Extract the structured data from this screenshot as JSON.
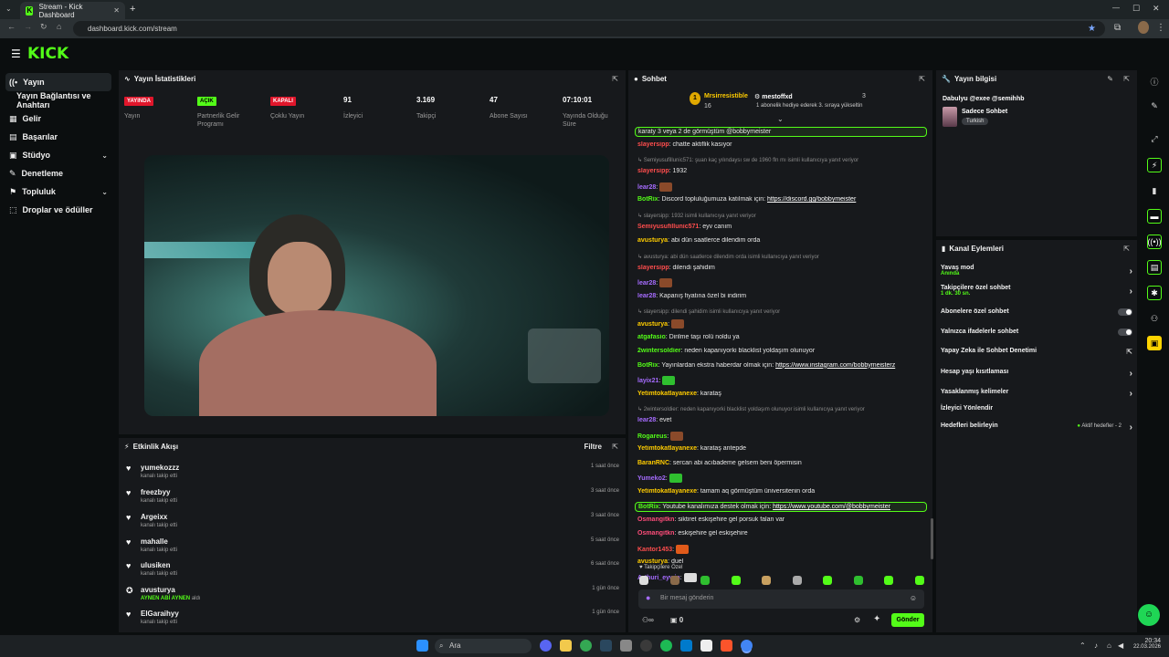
{
  "browser": {
    "tab_title": "Stream - Kick Dashboard",
    "url": "dashboard.kick.com/stream",
    "new_tab": "+",
    "minimize": "—",
    "maximize": "☐",
    "close": "✕"
  },
  "app": {
    "logo": "KICK"
  },
  "sidebar": {
    "items": [
      {
        "label": "Yayın",
        "icon": "live-icon"
      },
      {
        "label": "Yayın Bağlantısı ve Anahtarı"
      },
      {
        "label": "Gelir",
        "icon": "revenue-icon"
      },
      {
        "label": "Başarılar",
        "icon": "achievements-icon"
      },
      {
        "label": "Stüdyo",
        "icon": "studio-icon"
      },
      {
        "label": "Denetleme",
        "icon": "moderation-icon"
      },
      {
        "label": "Topluluk",
        "icon": "community-icon"
      },
      {
        "label": "Droplar ve ödüller",
        "icon": "drops-icon"
      }
    ]
  },
  "stats": {
    "title": "Yayın İstatistikleri",
    "items": [
      {
        "value": "YAYINDA",
        "label": "Yayın",
        "badge_color": "#e0162b"
      },
      {
        "value": "AÇIK",
        "label": "Partnerlik Gelir Programı",
        "badge_color": "#53fc18"
      },
      {
        "value": "KAPALI",
        "label": "Çoklu Yayın",
        "badge_color": "#e0162b"
      },
      {
        "value": "91",
        "label": "İzleyici"
      },
      {
        "value": "3.169",
        "label": "Takipçi"
      },
      {
        "value": "47",
        "label": "Abone Sayısı"
      },
      {
        "value": "07:10:01",
        "label": "Yayında Olduğu Süre"
      }
    ]
  },
  "activity": {
    "title": "Etkinlik Akışı",
    "filter": "Filtre",
    "rows": [
      {
        "user": "yumekozzz",
        "action": "kanalı takip etti",
        "time": "1 saat önce"
      },
      {
        "user": "freezbyy",
        "action": "kanalı takip etti",
        "time": "3 saat önce"
      },
      {
        "user": "Argeixx",
        "action": "kanalı takip etti",
        "time": "3 saat önce"
      },
      {
        "user": "mahalle",
        "action": "kanalı takip etti",
        "time": "5 saat önce"
      },
      {
        "user": "ulusiken",
        "action": "kanalı takip etti",
        "time": "6 saat önce"
      },
      {
        "user": "avusturya",
        "action_prefix": "AYNEN ABİ AYNEN",
        "action": "aldı",
        "time": "1 gün önce"
      },
      {
        "user": "ElGaraihyy",
        "action": "kanalı takip etti",
        "time": "1 gün önce"
      }
    ]
  },
  "chat": {
    "title": "Sohbet",
    "pinned_user1": "Mrsirresistible",
    "pinned_count1": "16",
    "pinned_user2": "mestoffxd",
    "pinned_count2": "3",
    "pinned_note": "1 abonelik hediye ederek 3. sıraya yükseltin",
    "lines": [
      {
        "u": "",
        "t": "karaty 3 veya 2 de görmüştüm @bobbymeister",
        "hl": true
      },
      {
        "u": "slayersipp",
        "c": "#ff4d4d",
        "t": ": chatte aktiflik kasıyor"
      },
      {
        "reply": "Semiyusufillunic571: şuan kaç yılındaysı sw de 1960 fln mı isimli kullanıcıya yanıt veriyor"
      },
      {
        "u": "slayersipp",
        "c": "#ff4d4d",
        "t": ": 1932"
      },
      {
        "u": "lear28",
        "c": "#a66cff",
        "t": ": ",
        "emote": "#8a4a2a"
      },
      {
        "u": "BotRix",
        "c": "#53fc18",
        "t": ": Discord topluluğumuza katılmak için: ",
        "link": "https://discord.gg/bobbymeister"
      },
      {
        "reply": "slayersipp: 1932 isimli kullanıcıya yanıt veriyor"
      },
      {
        "u": "Semiyusufillunic571",
        "c": "#ff4d4d",
        "t": ": eyv canım"
      },
      {
        "u": "avusturya",
        "c": "#ffcc00",
        "t": ": abi dün saatlerce dilendim orda"
      },
      {
        "reply": "avusturya: abi dün saatlerce dilendim orda isimli kullanıcıya yanıt veriyor"
      },
      {
        "u": "slayersipp",
        "c": "#ff4d4d",
        "t": ": dilendi şahidim"
      },
      {
        "u": "lear28",
        "c": "#a66cff",
        "t": ": ",
        "emote": "#8a4a2a"
      },
      {
        "u": "lear28",
        "c": "#a66cff",
        "t": ": Kapanış fiyatına özel bi indirim"
      },
      {
        "reply": "slayersipp: dilendi şahidim isimli kullanıcıya yanıt veriyor"
      },
      {
        "u": "avusturya",
        "c": "#ffcc00",
        "t": ": ",
        "emote": "#8a4a2a"
      },
      {
        "u": "atgafasio",
        "c": "#53fc18",
        "t": ": Dirilme taşı rolü noldu ya"
      },
      {
        "u": "2wintersoldier",
        "c": "#53fc18",
        "t": ": neden kapanıyorki blacklist yoldaşım olunuyor"
      },
      {
        "u": "BotRix",
        "c": "#53fc18",
        "t": ": Yayınlardan ekstra haberdar olmak için: ",
        "link": "https://www.instagram.com/bobbymeisterz"
      },
      {
        "u": "layix21",
        "c": "#a66cff",
        "t": ": ",
        "emote": "#2fbf2f"
      },
      {
        "u": "Yetimtokatlayanexe",
        "c": "#ffcc00",
        "t": ": karataş"
      },
      {
        "reply": "2wintersoldier: neden kapanıyorki blacklist yoldaşım olunuyor isimli kullanıcıya yanıt veriyor"
      },
      {
        "u": "lear28",
        "c": "#a66cff",
        "t": ": evet"
      },
      {
        "u": "Rogareus",
        "c": "#53fc18",
        "t": ": ",
        "emote": "#8a4a2a"
      },
      {
        "u": "Yetimtokatlayanexe",
        "c": "#ffcc00",
        "t": ": karataş antepde"
      },
      {
        "u": "BaranRNC",
        "c": "#ffcc00",
        "t": ": sercan abi acıbademe gelsem beni öpermisin"
      },
      {
        "u": "Yumeko2",
        "c": "#a66cff",
        "t": ": ",
        "emote": "#2fbf2f"
      },
      {
        "u": "Yetimtokatlayanexe",
        "c": "#ffcc00",
        "t": ": tamam aq görmüştüm üniversitenin orda"
      },
      {
        "u": "BotRix",
        "c": "#53fc18",
        "t": ": Youtube kanalımıza destek olmak için: ",
        "link": "https://www.youtube.com/@bobbymeister",
        "hl": true
      },
      {
        "u": "Osmangitkn",
        "c": "#ff4d7a",
        "t": ": siktiret eskişehire gel porsuk falan var"
      },
      {
        "u": "Osmangitkn",
        "c": "#ff4d7a",
        "t": ": eskişehire gel eskişehire"
      },
      {
        "u": "Kantor1453",
        "c": "#ff4d4d",
        "t": ": ",
        "emote": "#e05a1a"
      },
      {
        "u": "avusturya",
        "c": "#ffcc00",
        "t": ": duel"
      },
      {
        "u": "Arthuri_eywin",
        "c": "#a66cff",
        "t": ": ",
        "emote": "#dddddd"
      }
    ],
    "followers_only_label": "Takipçilere Özel",
    "input_placeholder": "Bir mesaj gönderin",
    "points": "0",
    "send_label": "Gönder"
  },
  "stream_info": {
    "title": "Yayın bilgisi",
    "stream_title": "Dabulyu @exee @semihhb",
    "mode": "Sadece Sohbet",
    "language": "Turkish"
  },
  "channel_actions": {
    "title": "Kanal Eylemleri",
    "items": [
      {
        "label": "Yavaş mod",
        "sub": "Anında",
        "kind": "arrow"
      },
      {
        "label": "Takipçilere özel sohbet",
        "sub": "1 dk. 30 sn.",
        "kind": "arrow"
      },
      {
        "label": "Abonelere özel sohbet",
        "kind": "toggle"
      },
      {
        "label": "Yalnızca ifadelerle sohbet",
        "kind": "toggle"
      },
      {
        "label": "Yapay Zeka ile Sohbet Denetimi",
        "kind": "external"
      },
      {
        "label": "Hesap yaşı kısıtlaması",
        "kind": "arrow"
      },
      {
        "label": "Yasaklanmış kelimeler",
        "kind": "arrow"
      },
      {
        "label": "İzleyici Yönlendir",
        "kind": "none"
      },
      {
        "label": "Hedefleri belirleyin",
        "status": "Aktif hedefler - 2",
        "kind": "arrow"
      }
    ]
  },
  "taskbar": {
    "search": "Ara",
    "time": "20:34",
    "date": "22.03.2026"
  }
}
